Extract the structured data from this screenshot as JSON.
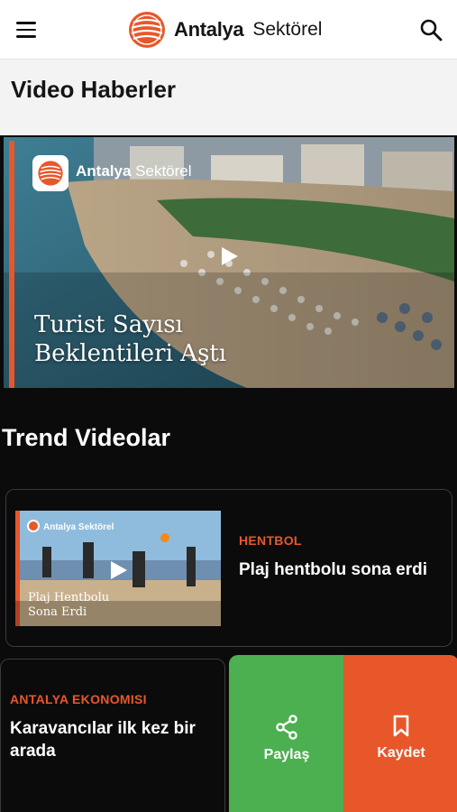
{
  "header": {
    "brand_name": "Antalya",
    "brand_sub": "Sektörel",
    "menu_icon": "hamburger-menu-icon",
    "search_icon": "search-icon"
  },
  "page": {
    "title": "Video Haberler"
  },
  "featured": {
    "brand_name": "Antalya",
    "brand_sub": "Sektörel",
    "caption_line1": "Turist Sayısı",
    "caption_line2": "Beklentileri Aştı"
  },
  "trend": {
    "title": "Trend Videolar",
    "items": [
      {
        "category": "HENTBOL",
        "title": "Plaj hentbolu sona erdi",
        "thumb_brand": "Antalya Sektörel",
        "thumb_caption_line1": "Plaj Hentbolu",
        "thumb_caption_line2": "Sona Erdi"
      },
      {
        "category": "ANTALYA EKONOMISI",
        "title": "Karavancılar ilk kez bir arada"
      }
    ]
  },
  "actions": {
    "share_label": "Paylaş",
    "save_label": "Kaydet"
  },
  "colors": {
    "accent": "#e8572a",
    "share": "#4caf50",
    "background": "#0b0b0b"
  }
}
